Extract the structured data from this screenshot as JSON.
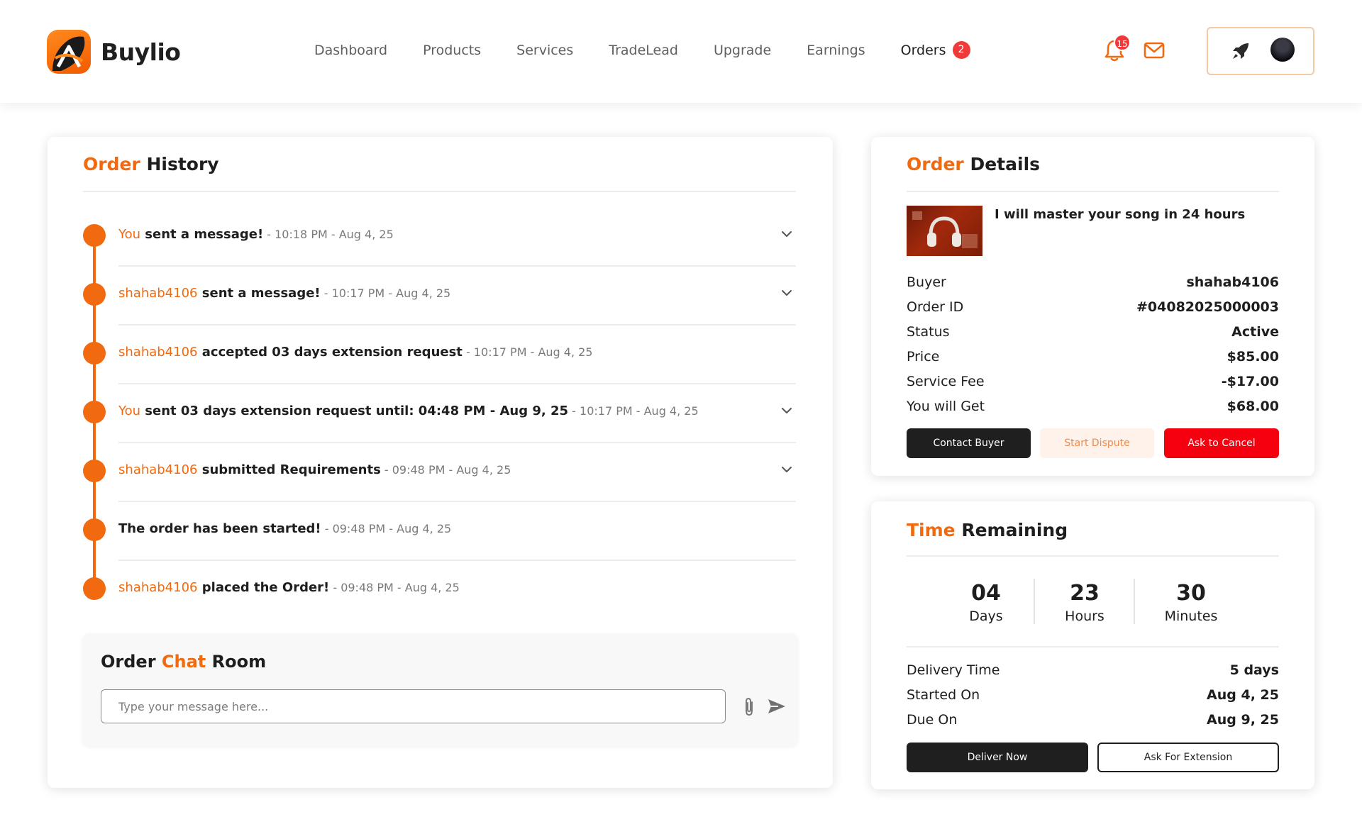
{
  "brand": {
    "name": "Buylio"
  },
  "nav": {
    "items": [
      "Dashboard",
      "Products",
      "Services",
      "TradeLead",
      "Upgrade",
      "Earnings",
      "Orders"
    ],
    "orders_badge": "2"
  },
  "header": {
    "notifications_count": "15"
  },
  "history": {
    "title_accent": "Order",
    "title_rest": " History",
    "events": [
      {
        "who": "You",
        "action": " sent a message!",
        "meta": " - 10:18 PM - Aug 4, 25"
      },
      {
        "who": "shahab4106",
        "action": " sent a message!",
        "meta": " - 10:17 PM - Aug 4, 25"
      },
      {
        "who": "shahab4106",
        "action": " accepted 03 days extension request",
        "meta": " - 10:17 PM - Aug 4, 25"
      },
      {
        "who": "You",
        "action": " sent 03 days extension request until: 04:48 PM - Aug 9, 25",
        "meta": " - 10:17 PM - Aug 4, 25"
      },
      {
        "who": "shahab4106",
        "action": " submitted Requirements",
        "meta": " - 09:48 PM - Aug 4, 25"
      },
      {
        "who": "",
        "action": "The order has been started!",
        "meta": " - 09:48 PM - Aug 4, 25"
      },
      {
        "who": "shahab4106",
        "action": " placed the Order!",
        "meta": " - 09:48 PM - Aug 4, 25"
      }
    ]
  },
  "chat": {
    "title_pre": "Order ",
    "title_accent": "Chat",
    "title_post": " Room",
    "placeholder": "Type your message here..."
  },
  "details": {
    "title_accent": "Order",
    "title_rest": " Details",
    "product_title": "I will master your song in 24 hours",
    "rows": [
      {
        "k": "Buyer",
        "v": "shahab4106"
      },
      {
        "k": "Order ID",
        "v": "#04082025000003"
      },
      {
        "k": "Status",
        "v": "Active"
      },
      {
        "k": "Price",
        "v": "$85.00"
      },
      {
        "k": "Service Fee",
        "v": "-$17.00"
      },
      {
        "k": "You will Get",
        "v": "$68.00"
      }
    ],
    "buttons": {
      "contact": "Contact Buyer",
      "dispute": "Start Dispute",
      "cancel": "Ask to Cancel"
    }
  },
  "time": {
    "title_accent": "Time",
    "title_rest": " Remaining",
    "counters": [
      {
        "num": "04",
        "lbl": "Days"
      },
      {
        "num": "23",
        "lbl": "Hours"
      },
      {
        "num": "30",
        "lbl": "Minutes"
      }
    ],
    "rows": [
      {
        "k": "Delivery Time",
        "v": "5 days"
      },
      {
        "k": "Started On",
        "v": "Aug 4, 25"
      },
      {
        "k": "Due On",
        "v": "Aug 9, 25"
      }
    ],
    "buttons": {
      "deliver": "Deliver Now",
      "extension": "Ask For Extension"
    }
  },
  "colors": {
    "accent": "#f26a0f",
    "danger": "#f5000f",
    "dark": "#1f1f1f"
  },
  "icons": [
    "bell-icon",
    "mail-icon",
    "rocket-icon",
    "chevron-down-icon",
    "paperclip-icon",
    "send-icon"
  ]
}
